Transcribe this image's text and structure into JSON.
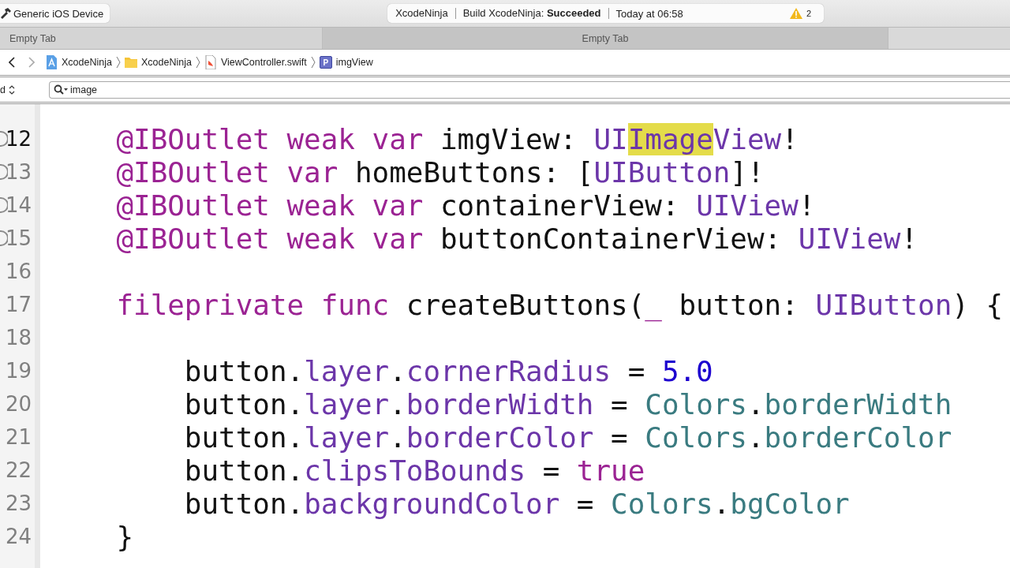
{
  "toolbar": {
    "scheme": "Generic iOS Device",
    "activity": {
      "project": "XcodeNinja",
      "status": "Build XcodeNinja: **Succeeded**",
      "time": "Today at 06:58",
      "warnings": "2"
    }
  },
  "tabs": [
    {
      "label": "Empty Tab",
      "selected": false
    },
    {
      "label": "Empty Tab",
      "selected": true
    }
  ],
  "jump_bar": {
    "back_enabled": true,
    "forward_enabled": false,
    "items": [
      {
        "kind": "project",
        "label": "XcodeNinja"
      },
      {
        "kind": "folder",
        "label": "XcodeNinja"
      },
      {
        "kind": "file",
        "label": "ViewController.swift"
      },
      {
        "kind": "property",
        "label": "imgView",
        "icon_text": "P"
      }
    ]
  },
  "filter_bar": {
    "popup": "d",
    "search": "image"
  },
  "editor": {
    "lines": [
      {
        "number": "12",
        "current": true,
        "outlet": true,
        "tokens": [
          {
            "text": "    @IBOutlet ",
            "kind": "keyword"
          },
          {
            "text": "weak ",
            "kind": "keyword"
          },
          {
            "text": "var",
            "kind": "keyword"
          },
          {
            "text": " imgView: ",
            "kind": "plain"
          },
          {
            "text": "UI",
            "kind": "type"
          },
          {
            "text": "Image",
            "kind": "type",
            "match": true
          },
          {
            "text": "View",
            "kind": "type"
          },
          {
            "text": "!",
            "kind": "plain"
          }
        ]
      },
      {
        "number": "13",
        "current": false,
        "outlet": true,
        "tokens": [
          {
            "text": "    @IBOutlet ",
            "kind": "keyword"
          },
          {
            "text": "var",
            "kind": "keyword"
          },
          {
            "text": " homeButtons: [",
            "kind": "plain"
          },
          {
            "text": "UIButton",
            "kind": "type"
          },
          {
            "text": "]!",
            "kind": "plain"
          }
        ]
      },
      {
        "number": "14",
        "current": false,
        "outlet": true,
        "tokens": [
          {
            "text": "    @IBOutlet ",
            "kind": "keyword"
          },
          {
            "text": "weak ",
            "kind": "keyword"
          },
          {
            "text": "var",
            "kind": "keyword"
          },
          {
            "text": " containerView: ",
            "kind": "plain"
          },
          {
            "text": "UIView",
            "kind": "type"
          },
          {
            "text": "!",
            "kind": "plain"
          }
        ]
      },
      {
        "number": "15",
        "current": false,
        "outlet": true,
        "tokens": [
          {
            "text": "    @IBOutlet ",
            "kind": "keyword"
          },
          {
            "text": "weak ",
            "kind": "keyword"
          },
          {
            "text": "var",
            "kind": "keyword"
          },
          {
            "text": " buttonContainerView: ",
            "kind": "plain"
          },
          {
            "text": "UIView",
            "kind": "type"
          },
          {
            "text": "!",
            "kind": "plain"
          }
        ]
      },
      {
        "number": "16",
        "current": false,
        "outlet": false
      },
      {
        "number": "17",
        "current": false,
        "outlet": false,
        "tokens": [
          {
            "text": "    fileprivate ",
            "kind": "keyword"
          },
          {
            "text": "func",
            "kind": "keyword"
          },
          {
            "text": " createButtons(",
            "kind": "plain"
          },
          {
            "text": "_",
            "kind": "keyword"
          },
          {
            "text": " button: ",
            "kind": "plain"
          },
          {
            "text": "UIButton",
            "kind": "type"
          },
          {
            "text": ") {",
            "kind": "plain"
          }
        ]
      },
      {
        "number": "18",
        "current": false,
        "outlet": false
      },
      {
        "number": "19",
        "current": false,
        "outlet": false,
        "tokens": [
          {
            "text": "        button.",
            "kind": "plain"
          },
          {
            "text": "layer",
            "kind": "property"
          },
          {
            "text": ".",
            "kind": "plain"
          },
          {
            "text": "cornerRadius",
            "kind": "property"
          },
          {
            "text": " = ",
            "kind": "plain"
          },
          {
            "text": "5.0",
            "kind": "number"
          }
        ]
      },
      {
        "number": "20",
        "current": false,
        "outlet": false,
        "tokens": [
          {
            "text": "        button.",
            "kind": "plain"
          },
          {
            "text": "layer",
            "kind": "property"
          },
          {
            "text": ".",
            "kind": "plain"
          },
          {
            "text": "borderWidth",
            "kind": "property"
          },
          {
            "text": " = ",
            "kind": "plain"
          },
          {
            "text": "Colors",
            "kind": "project"
          },
          {
            "text": ".",
            "kind": "plain"
          },
          {
            "text": "borderWidth",
            "kind": "project"
          }
        ]
      },
      {
        "number": "21",
        "current": false,
        "outlet": false,
        "tokens": [
          {
            "text": "        button.",
            "kind": "plain"
          },
          {
            "text": "layer",
            "kind": "property"
          },
          {
            "text": ".",
            "kind": "plain"
          },
          {
            "text": "borderColor",
            "kind": "property"
          },
          {
            "text": " = ",
            "kind": "plain"
          },
          {
            "text": "Colors",
            "kind": "project"
          },
          {
            "text": ".",
            "kind": "plain"
          },
          {
            "text": "borderColor",
            "kind": "project"
          }
        ]
      },
      {
        "number": "22",
        "current": false,
        "outlet": false,
        "tokens": [
          {
            "text": "        button.",
            "kind": "plain"
          },
          {
            "text": "clipsToBounds",
            "kind": "property"
          },
          {
            "text": " = ",
            "kind": "plain"
          },
          {
            "text": "true",
            "kind": "keyword"
          }
        ]
      },
      {
        "number": "23",
        "current": false,
        "outlet": false,
        "tokens": [
          {
            "text": "        button.",
            "kind": "plain"
          },
          {
            "text": "backgroundColor",
            "kind": "property"
          },
          {
            "text": " = ",
            "kind": "plain"
          },
          {
            "text": "Colors",
            "kind": "project"
          },
          {
            "text": ".",
            "kind": "plain"
          },
          {
            "text": "bgColor",
            "kind": "project"
          }
        ]
      },
      {
        "number": "24",
        "current": false,
        "outlet": false,
        "tokens": [
          {
            "text": "    }",
            "kind": "plain"
          }
        ]
      }
    ]
  }
}
